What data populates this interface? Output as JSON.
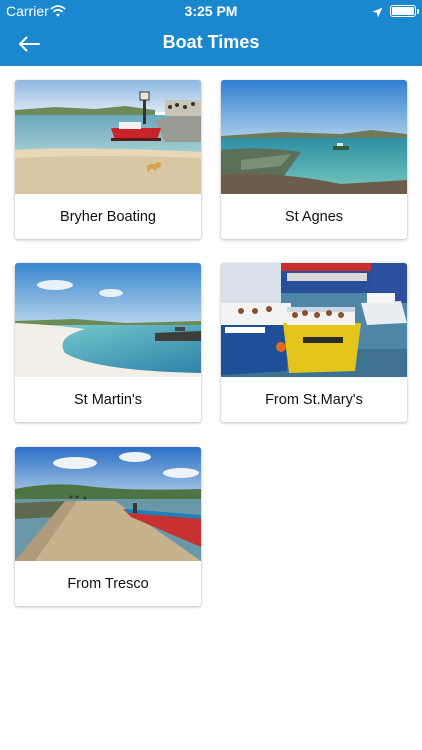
{
  "status_bar": {
    "carrier": "Carrier",
    "time": "3:25 PM",
    "wifi_icon": "wifi-icon",
    "location_icon": "location-arrow-icon",
    "battery_icon": "battery-icon"
  },
  "navbar": {
    "title": "Boat Times",
    "back_icon": "arrow-left-icon",
    "background": "#1a87cf"
  },
  "cards": [
    {
      "label": "Bryher Boating",
      "image": "harbour-with-red-boat-and-dog"
    },
    {
      "label": "St Agnes",
      "image": "clear-water-bay-with-boat"
    },
    {
      "label": "St Martin's",
      "image": "white-sand-beach-and-sea"
    },
    {
      "label": "From St.Mary's",
      "image": "crowded-passenger-boats-in-harbour"
    },
    {
      "label": "From Tresco",
      "image": "quay-with-red-and-blue-boat"
    }
  ]
}
